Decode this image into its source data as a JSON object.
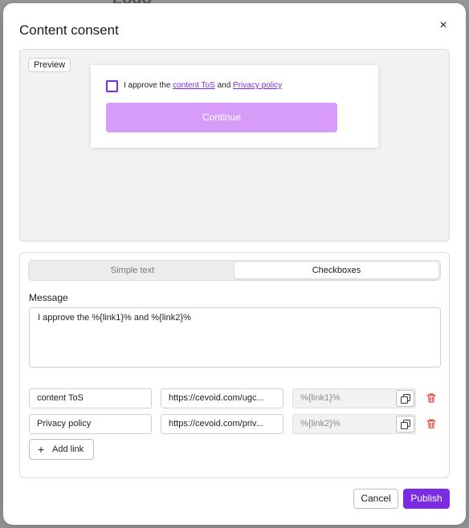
{
  "background": {
    "partial_title": "Logo"
  },
  "dialog": {
    "title": "Content consent",
    "close_glyph": "×"
  },
  "preview": {
    "tag_label": "Preview",
    "consent_prefix": "I approve the",
    "link1_text": "content ToS",
    "conjunction": "and",
    "link2_text": "Privacy policy",
    "continue_label": "Continue"
  },
  "mode_tabs": {
    "options": [
      "Simple text",
      "Checkboxes"
    ],
    "selected": "Checkboxes"
  },
  "message": {
    "label": "Message",
    "value": "I approve the %{link1}% and %{link2}%"
  },
  "links": [
    {
      "text": "content ToS",
      "url": "https://cevoid.com/ugc...",
      "token": "%{link1}%"
    },
    {
      "text": "Privacy policy",
      "url": "https://cevoid.com/priv...",
      "token": "%{link2}%"
    }
  ],
  "add_link_label": "Add link",
  "footer": {
    "cancel_label": "Cancel",
    "publish_label": "Publish"
  },
  "colors": {
    "accent": "#7c2ce0",
    "accent_light": "#d69cf8",
    "danger": "#e0413a"
  },
  "icons": {
    "close": "close-icon",
    "copy": "copy-icon",
    "trash": "trash-icon",
    "plus": "plus-icon"
  }
}
